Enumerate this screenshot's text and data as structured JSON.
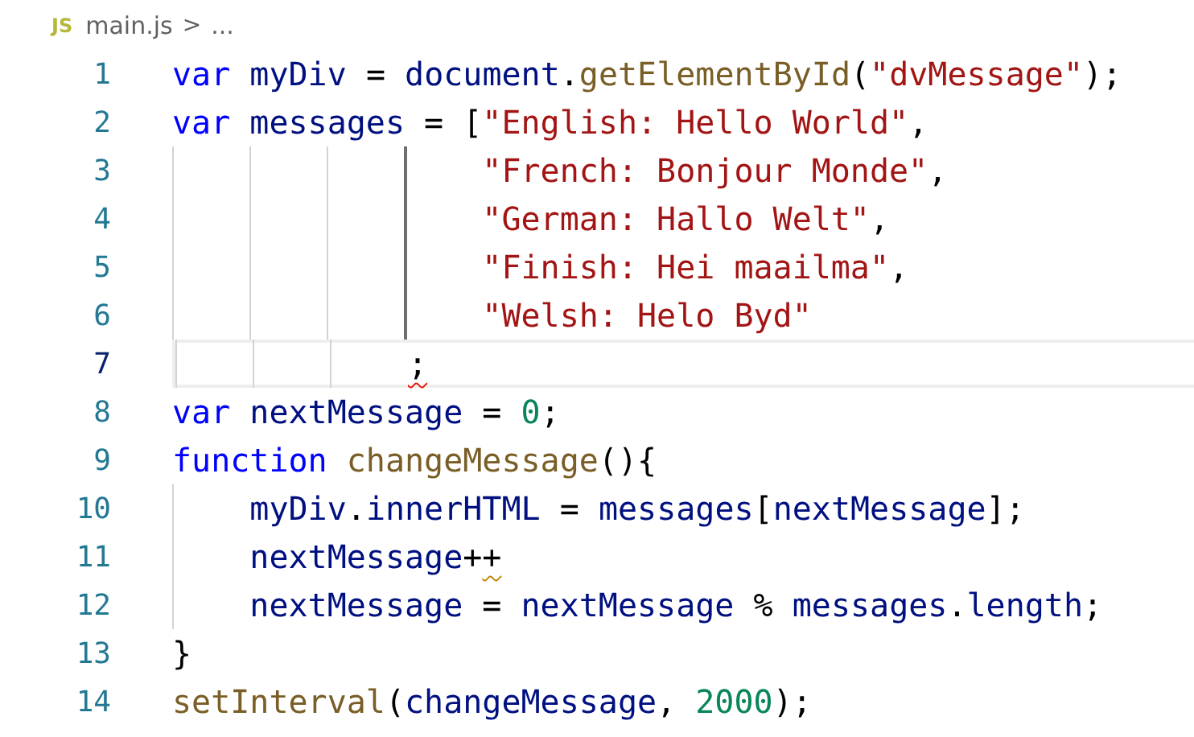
{
  "breadcrumb": {
    "file_icon": "JS",
    "file": "main.js",
    "separator": ">",
    "rest": "..."
  },
  "lines": [
    {
      "number": "1",
      "current": false,
      "tokens": [
        {
          "text": "var",
          "kind": "keyword"
        },
        {
          "text": " myDiv",
          "kind": "variable"
        },
        {
          "text": " = ",
          "kind": "plain"
        },
        {
          "text": "document",
          "kind": "variable"
        },
        {
          "text": ".",
          "kind": "plain"
        },
        {
          "text": "getElementById",
          "kind": "function"
        },
        {
          "text": "(",
          "kind": "plain"
        },
        {
          "text": "\"dvMessage\"",
          "kind": "string"
        },
        {
          "text": ");",
          "kind": "plain"
        }
      ]
    },
    {
      "number": "2",
      "current": false,
      "tokens": [
        {
          "text": "var",
          "kind": "keyword"
        },
        {
          "text": " messages",
          "kind": "variable"
        },
        {
          "text": " = [",
          "kind": "plain"
        },
        {
          "text": "\"English: Hello World\"",
          "kind": "string"
        },
        {
          "text": ",",
          "kind": "plain"
        }
      ]
    },
    {
      "number": "3",
      "current": false,
      "active_guide": true,
      "tokens": [
        {
          "text": "                \"French: Bonjour Monde\"",
          "kind": "string"
        },
        {
          "text": ",",
          "kind": "plain"
        }
      ]
    },
    {
      "number": "4",
      "current": false,
      "active_guide": true,
      "tokens": [
        {
          "text": "                \"German: Hallo Welt\"",
          "kind": "string"
        },
        {
          "text": ",",
          "kind": "plain"
        }
      ]
    },
    {
      "number": "5",
      "current": false,
      "active_guide": true,
      "tokens": [
        {
          "text": "                \"Finish: Hei maailma\"",
          "kind": "string"
        },
        {
          "text": ",",
          "kind": "plain"
        }
      ]
    },
    {
      "number": "6",
      "current": false,
      "active_guide": true,
      "tokens": [
        {
          "text": "                \"Welsh: Helo Byd\"",
          "kind": "string"
        }
      ]
    },
    {
      "number": "7",
      "current": true,
      "active_guide": false,
      "tokens": [
        {
          "text": "            ;",
          "kind": "plain",
          "error": true
        }
      ]
    },
    {
      "number": "8",
      "current": false,
      "tokens": [
        {
          "text": "var",
          "kind": "keyword"
        },
        {
          "text": " nextMessage",
          "kind": "variable"
        },
        {
          "text": " = ",
          "kind": "plain"
        },
        {
          "text": "0",
          "kind": "number"
        },
        {
          "text": ";",
          "kind": "plain"
        }
      ]
    },
    {
      "number": "9",
      "current": false,
      "tokens": [
        {
          "text": "function",
          "kind": "keyword"
        },
        {
          "text": " changeMessage",
          "kind": "function"
        },
        {
          "text": "(){",
          "kind": "plain"
        }
      ]
    },
    {
      "number": "10",
      "current": false,
      "active_guide": false,
      "tokens": [
        {
          "text": "    myDiv",
          "kind": "variable"
        },
        {
          "text": ".",
          "kind": "plain"
        },
        {
          "text": "innerHTML",
          "kind": "variable"
        },
        {
          "text": " = ",
          "kind": "plain"
        },
        {
          "text": "messages",
          "kind": "variable"
        },
        {
          "text": "[",
          "kind": "plain"
        },
        {
          "text": "nextMessage",
          "kind": "variable"
        },
        {
          "text": "];",
          "kind": "plain"
        }
      ]
    },
    {
      "number": "11",
      "current": false,
      "active_guide": false,
      "tokens": [
        {
          "text": "    nextMessage",
          "kind": "variable"
        },
        {
          "text": "+",
          "kind": "plain"
        },
        {
          "text": "+",
          "kind": "plain",
          "warning": true
        }
      ]
    },
    {
      "number": "12",
      "current": false,
      "active_guide": false,
      "tokens": [
        {
          "text": "    nextMessage",
          "kind": "variable"
        },
        {
          "text": " = ",
          "kind": "plain"
        },
        {
          "text": "nextMessage",
          "kind": "variable"
        },
        {
          "text": " % ",
          "kind": "plain"
        },
        {
          "text": "messages",
          "kind": "variable"
        },
        {
          "text": ".",
          "kind": "plain"
        },
        {
          "text": "length",
          "kind": "variable"
        },
        {
          "text": ";",
          "kind": "plain"
        }
      ]
    },
    {
      "number": "13",
      "current": false,
      "tokens": [
        {
          "text": "}",
          "kind": "plain"
        }
      ]
    },
    {
      "number": "14",
      "current": false,
      "tokens": [
        {
          "text": "setInterval",
          "kind": "function"
        },
        {
          "text": "(",
          "kind": "plain"
        },
        {
          "text": "changeMessage",
          "kind": "variable"
        },
        {
          "text": ", ",
          "kind": "plain"
        },
        {
          "text": "2000",
          "kind": "number"
        },
        {
          "text": ");",
          "kind": "plain"
        }
      ]
    }
  ]
}
